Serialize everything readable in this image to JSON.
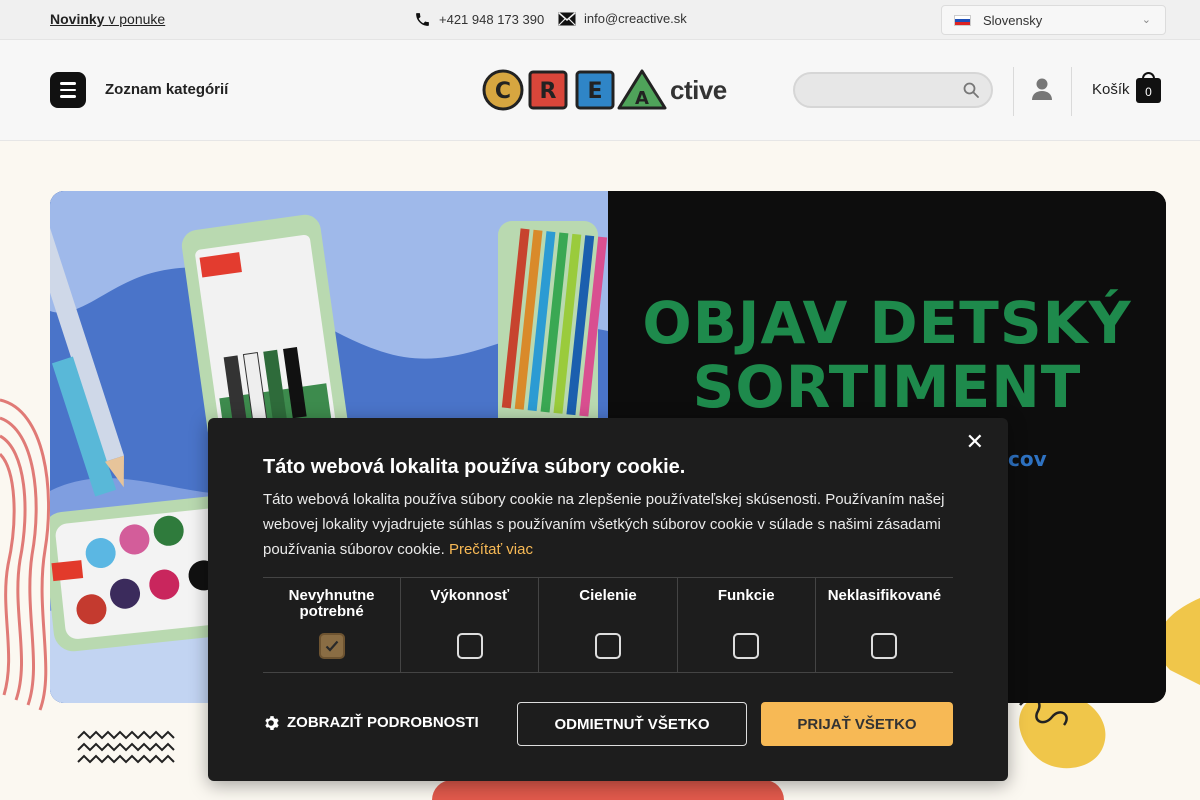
{
  "topbar": {
    "novinky_bold": "Novinky",
    "novinky_rest": "v ponuke",
    "phone": "+421 948 173 390",
    "email": "info@creactive.sk",
    "language": "Slovensky"
  },
  "header": {
    "categories_label": "Zoznam kategórií",
    "logo_letters": [
      "C",
      "R",
      "E",
      "A"
    ],
    "logo_suffix": "ctive",
    "search_placeholder": "",
    "cart_label": "Košík",
    "cart_count": "0"
  },
  "banner": {
    "headline_line1": "OBJAV DETSKÝ",
    "headline_line2": "SORTIMENT",
    "subline_visible_fragment": "cov",
    "colors": {
      "headline": "#1e8a4c",
      "background": "#0d0d0d"
    }
  },
  "cookie": {
    "title": "Táto webová lokalita používa súbory cookie.",
    "description": "Táto webová lokalita používa súbory cookie na zlepšenie používateľskej skúsenosti. Používaním našej webovej lokality vyjadrujete súhlas s používaním všetkých súborov cookie v súlade s našimi zásadami používania súborov cookie.",
    "read_more": "Prečítať viac",
    "categories": [
      {
        "label": "Nevyhnutne potrebné",
        "checked": true
      },
      {
        "label": "Výkonnosť",
        "checked": false
      },
      {
        "label": "Cielenie",
        "checked": false
      },
      {
        "label": "Funkcie",
        "checked": false
      },
      {
        "label": "Neklasifikované",
        "checked": false
      }
    ],
    "show_details": "ZOBRAZIŤ PODROBNOSTI",
    "decline_all": "ODMIETNUŤ VŠETKO",
    "accept_all": "PRIJAŤ VŠETKO",
    "colors": {
      "accent": "#f7b955",
      "panel": "#1d1d1d"
    }
  }
}
